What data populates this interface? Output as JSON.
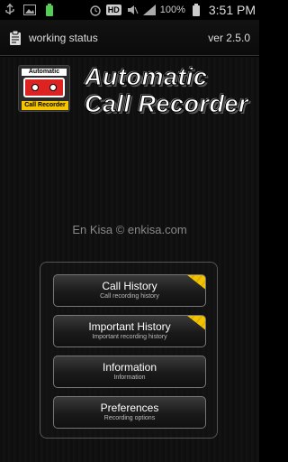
{
  "status_bar": {
    "icons": [
      "usb-icon",
      "image-icon",
      "battery-small-icon",
      "alarm-icon",
      "hd-icon",
      "mute-icon",
      "signal-icon"
    ],
    "hd_label": "HD",
    "battery": "100%",
    "time": "3:51 PM"
  },
  "titlebar": {
    "icon": "clipboard-icon",
    "title": "working status",
    "version": "ver 2.5.0"
  },
  "logo": {
    "top_label": "Automatic",
    "bottom_label": "Call Recorder",
    "title_line1": "Automatic",
    "title_line2": "Call Recorder"
  },
  "credit": "En Kisa © enkisa.com",
  "menu": [
    {
      "title": "Call History",
      "subtitle": "Call recording history",
      "ribbon": true
    },
    {
      "title": "Important History",
      "subtitle": "Important recording history",
      "ribbon": true
    },
    {
      "title": "Information",
      "subtitle": "Information",
      "ribbon": false
    },
    {
      "title": "Preferences",
      "subtitle": "Recording options",
      "ribbon": false
    }
  ],
  "colors": {
    "accent_ribbon": "#f2c300",
    "logo_red": "#dd2222"
  }
}
